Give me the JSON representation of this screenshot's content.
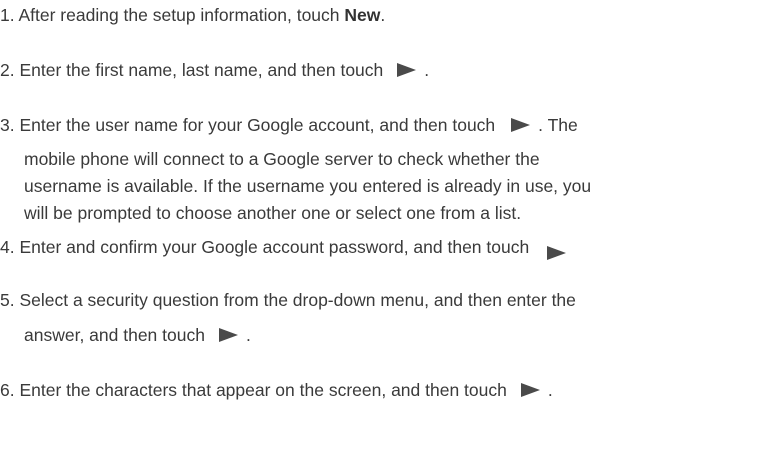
{
  "steps": {
    "s1": {
      "before": "1. After reading the setup information, touch ",
      "bold": "New",
      "after": "."
    },
    "s2": {
      "text": "2. Enter the first name, last name, and then touch",
      "after": "."
    },
    "s3": {
      "text": "3. Enter the user name for your Google account, and then touch",
      "after": ". The",
      "cont1": "mobile phone will connect to a Google server to check whether the",
      "cont2": "username is available. If the username you entered is already in use, you",
      "cont3": "will be prompted to choose another one or select one from a list."
    },
    "s4": {
      "text": "4. Enter and confirm your Google account password, and then touch"
    },
    "s5": {
      "text": "5. Select a security question from the drop-down menu, and then enter the",
      "cont1": "answer, and then touch",
      "after": "."
    },
    "s6": {
      "text": "6. Enter the characters that appear on the screen, and then touch",
      "after": "."
    }
  },
  "icons": {
    "next": "next-arrow-icon"
  }
}
